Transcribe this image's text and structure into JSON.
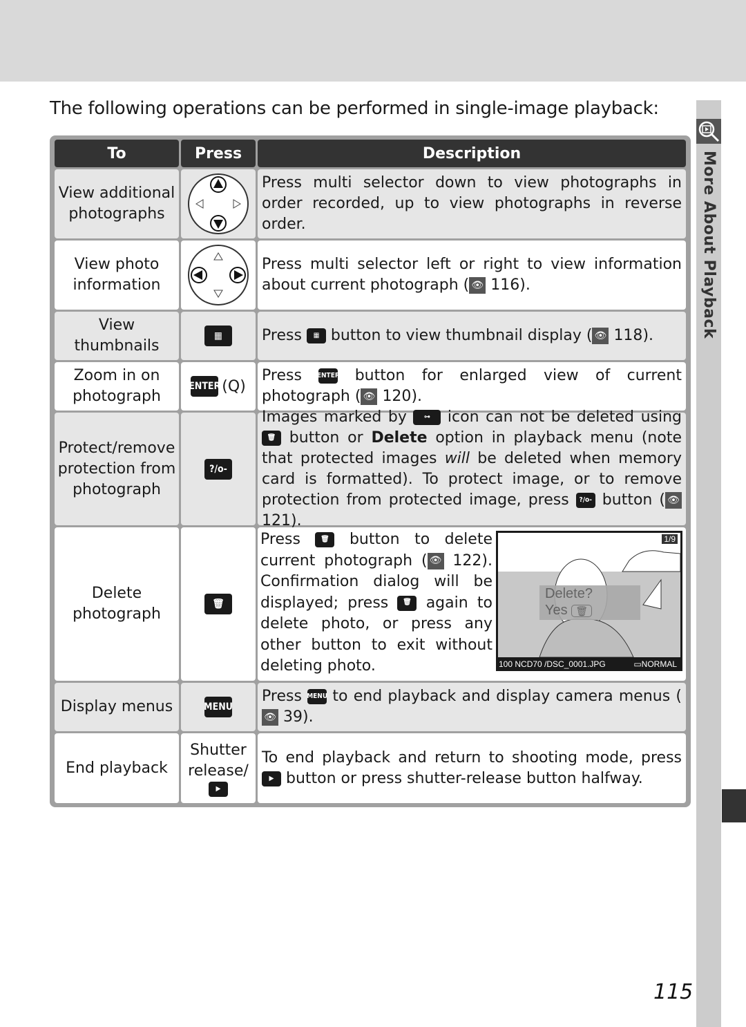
{
  "intro": "The following operations can be performed in single-image playback:",
  "side_tab_label": "More About Playback",
  "page_number": "115",
  "table": {
    "headers": [
      "To",
      "Press",
      "Description"
    ],
    "rows": [
      {
        "to": "View additional photographs",
        "press_icon": "multi-selector-up-down-icon",
        "desc": "Press multi selector down to view photographs in order recorded, up to view photographs in reverse order."
      },
      {
        "to": "View photo information",
        "press_icon": "multi-selector-left-right-icon",
        "desc_pre": "Press multi selector left or right to view information about current photograph (",
        "ref": "116",
        "desc_post": ")."
      },
      {
        "to": "View thumbnails",
        "press_icon": "thumbnail-button-icon",
        "desc_pre": "Press ",
        "desc_mid": " button to view thumbnail display (",
        "ref": "118",
        "desc_post": ")."
      },
      {
        "to": "Zoom in on photograph",
        "press_label": "ENTER",
        "press_extra": "(Q)",
        "desc_pre": "Press ",
        "desc_mid": " button for enlarged view of current photograph (",
        "ref": "120",
        "desc_post": ")."
      },
      {
        "to": "Protect/remove protection from photograph",
        "press_label": "?/o-",
        "desc_a": "Images marked by ",
        "desc_b": " icon can not be deleted using ",
        "desc_c": " button or ",
        "desc_bold": "Delete",
        "desc_d": " option in playback menu (note that protected images ",
        "desc_italic": "will",
        "desc_e": " be deleted when memory card is formatted).  To protect image, or to remove protection from protected image, press ",
        "desc_f": " button (",
        "ref": "121",
        "desc_post": ")."
      },
      {
        "to": "Delete photograph",
        "press_icon": "trash-button-icon",
        "desc_a": "Press ",
        "desc_b": " button to delete current photograph (",
        "ref": "122",
        "desc_c": "). Confirmation dialog will be displayed; press ",
        "desc_d": " again to delete photo, or press any other button to exit without deleting photo.",
        "screen": {
          "counter": "1/9",
          "dialog_title": "Delete?",
          "dialog_option": "Yes",
          "folder_file": "100 NCD70 /DSC_0001.JPG",
          "quality": "NORMAL"
        }
      },
      {
        "to": "Display menus",
        "press_label": "MENU",
        "desc_pre": "Press ",
        "desc_mid": " to end playback and display camera menus (",
        "ref": "39",
        "desc_post": ")."
      },
      {
        "to": "End playback",
        "press_text": "Shutter release/",
        "press_icon": "playback-button-icon",
        "desc_pre": "To end playback and return to shooting mode, press ",
        "desc_post": " button or press shutter-release button halfway."
      }
    ]
  }
}
